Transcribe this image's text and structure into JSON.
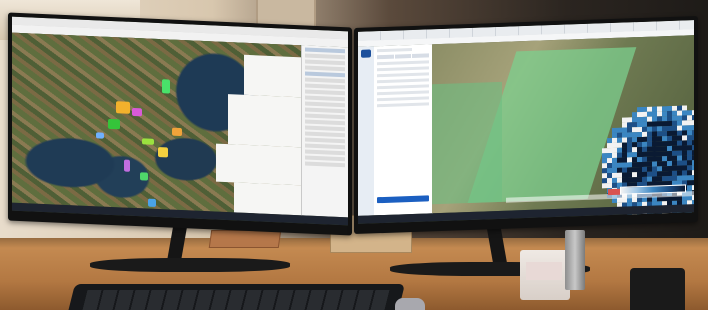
{
  "scene": {
    "left_monitor": {
      "brand_label": ""
    },
    "right_monitor": {
      "brand_label": ""
    }
  },
  "colors": {
    "map_water": "#1e3a55",
    "app_accent": "#1b5fc1",
    "field_green": "#7ccf8e",
    "heat_dark": "#0a1a33",
    "heat_mid": "#3b86c2",
    "heat_light": "#9fc6e6"
  },
  "icons": [
    "app-logo-icon",
    "taskbar-icons"
  ]
}
